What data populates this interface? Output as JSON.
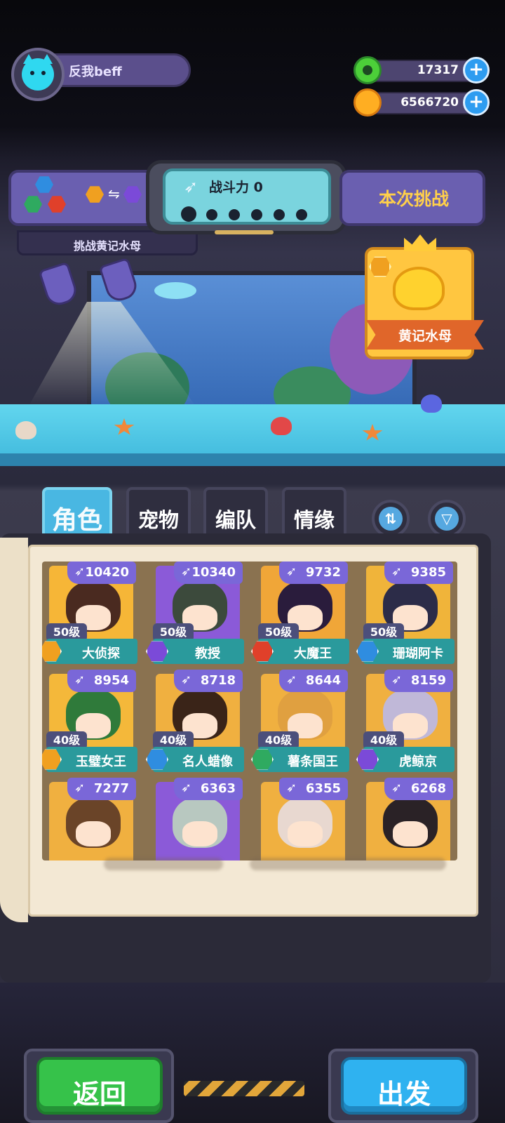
{
  "player": {
    "name": "反我beff"
  },
  "currencies": [
    {
      "name": "donut",
      "value": "17317",
      "icon": "green-donut-icon",
      "color": "#4ccf39"
    },
    {
      "name": "gold",
      "value": "6566720",
      "icon": "orange-planet-coin-icon",
      "color": "#ffae22"
    }
  ],
  "challenge": {
    "power_label": "战斗力 0",
    "current_label": "本次挑战",
    "target_label": "挑战黄记水母",
    "slots": 6
  },
  "boss": {
    "name": "黄记水母"
  },
  "tabs": [
    {
      "label": "角色",
      "active": true
    },
    {
      "label": "宠物",
      "active": false
    },
    {
      "label": "编队",
      "active": false
    },
    {
      "label": "情缘",
      "active": false
    }
  ],
  "toolbar": {
    "sort_icon": "sort-arrows-icon",
    "filter_icon": "filter-funnel-icon"
  },
  "characters": [
    {
      "name": "大侦探",
      "level": "50级",
      "power": "10420",
      "element": "gold",
      "element_color": "#f0a020",
      "bg": "#f6b637",
      "hair": "#4a2a20"
    },
    {
      "name": "教授",
      "level": "50级",
      "power": "10340",
      "element": "purple",
      "element_color": "#7b4ad8",
      "bg": "#8b5ad8",
      "hair": "#3c4a3c"
    },
    {
      "name": "大魔王",
      "level": "50级",
      "power": "9732",
      "element": "red",
      "element_color": "#e0402a",
      "bg": "#f0a638",
      "hair": "#2a1c3c"
    },
    {
      "name": "珊瑚阿卡",
      "level": "50级",
      "power": "9385",
      "element": "blue",
      "element_color": "#2f8de0",
      "bg": "#f0b43a",
      "hair": "#2c2c48"
    },
    {
      "name": "玉璧女王",
      "level": "40级",
      "power": "8954",
      "element": "gold",
      "element_color": "#f0a020",
      "bg": "#f4b83a",
      "hair": "#2f7a3a"
    },
    {
      "name": "名人蜡像",
      "level": "40级",
      "power": "8718",
      "element": "blue",
      "element_color": "#2f8de0",
      "bg": "#f0b040",
      "hair": "#3a2418"
    },
    {
      "name": "薯条国王",
      "level": "40级",
      "power": "8644",
      "element": "green",
      "element_color": "#2faa60",
      "bg": "#f0b040",
      "hair": "#e0a040"
    },
    {
      "name": "虎鲸京",
      "level": "40级",
      "power": "8159",
      "element": "purple",
      "element_color": "#7b4ad8",
      "bg": "#f0b040",
      "hair": "#c0b8d8"
    },
    {
      "name": "",
      "level": "",
      "power": "7277",
      "element": "",
      "element_color": "#888",
      "bg": "#f0b040",
      "hair": "#6a4428"
    },
    {
      "name": "",
      "level": "",
      "power": "6363",
      "element": "",
      "element_color": "#888",
      "bg": "#8b5ad8",
      "hair": "#b8c8c0"
    },
    {
      "name": "",
      "level": "",
      "power": "6355",
      "element": "",
      "element_color": "#888",
      "bg": "#f0b040",
      "hair": "#e8d8d0"
    },
    {
      "name": "",
      "level": "",
      "power": "6268",
      "element": "",
      "element_color": "#888",
      "bg": "#f0b040",
      "hair": "#2a2226"
    }
  ],
  "buttons": {
    "back": "返回",
    "go": "出发"
  }
}
